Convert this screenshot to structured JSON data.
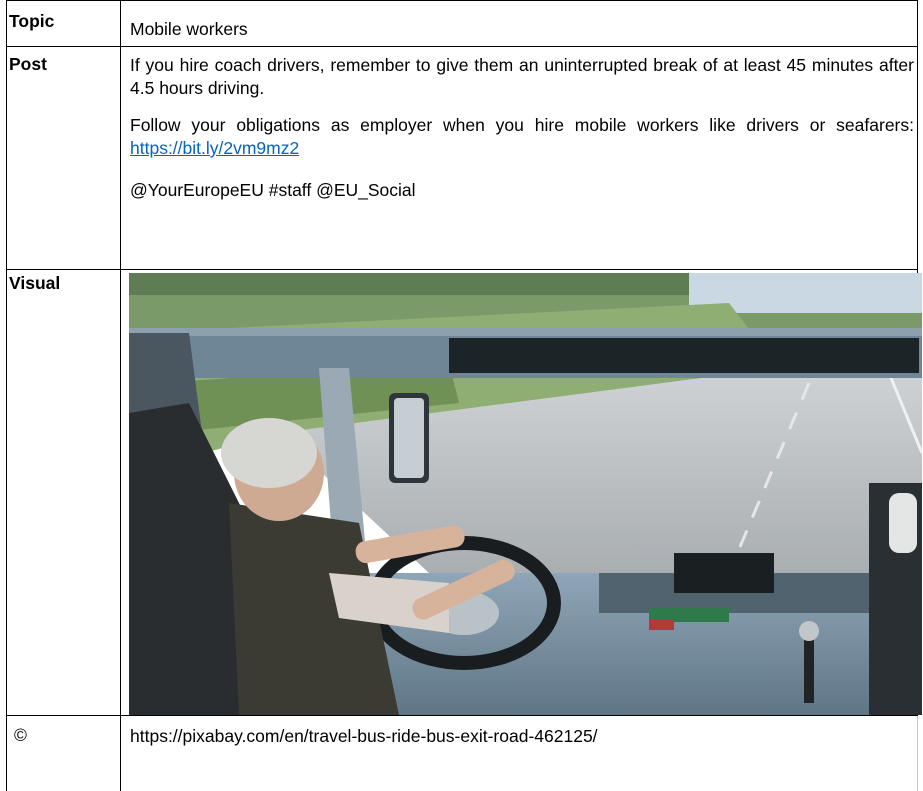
{
  "rows": {
    "topic": {
      "label": "Topic",
      "value": "Mobile workers"
    },
    "post": {
      "label": "Post",
      "paragraph1": "If you hire coach drivers, remember to give them an uninterrupted break of at least 45 minutes after 4.5 hours driving.",
      "paragraph2_prefix": "Follow your obligations as employer when you hire mobile workers like drivers or seafarers: ",
      "paragraph2_link": "https://bit.ly/2vm9mz2",
      "paragraph3": "@YourEuropeEU #staff @EU_Social"
    },
    "visual": {
      "label": "Visual"
    },
    "credit": {
      "label": "©",
      "value": "https://pixabay.com/en/travel-bus-ride-bus-exit-road-462125/"
    }
  },
  "colors": {
    "link": "#0563c1",
    "border": "#000000"
  }
}
